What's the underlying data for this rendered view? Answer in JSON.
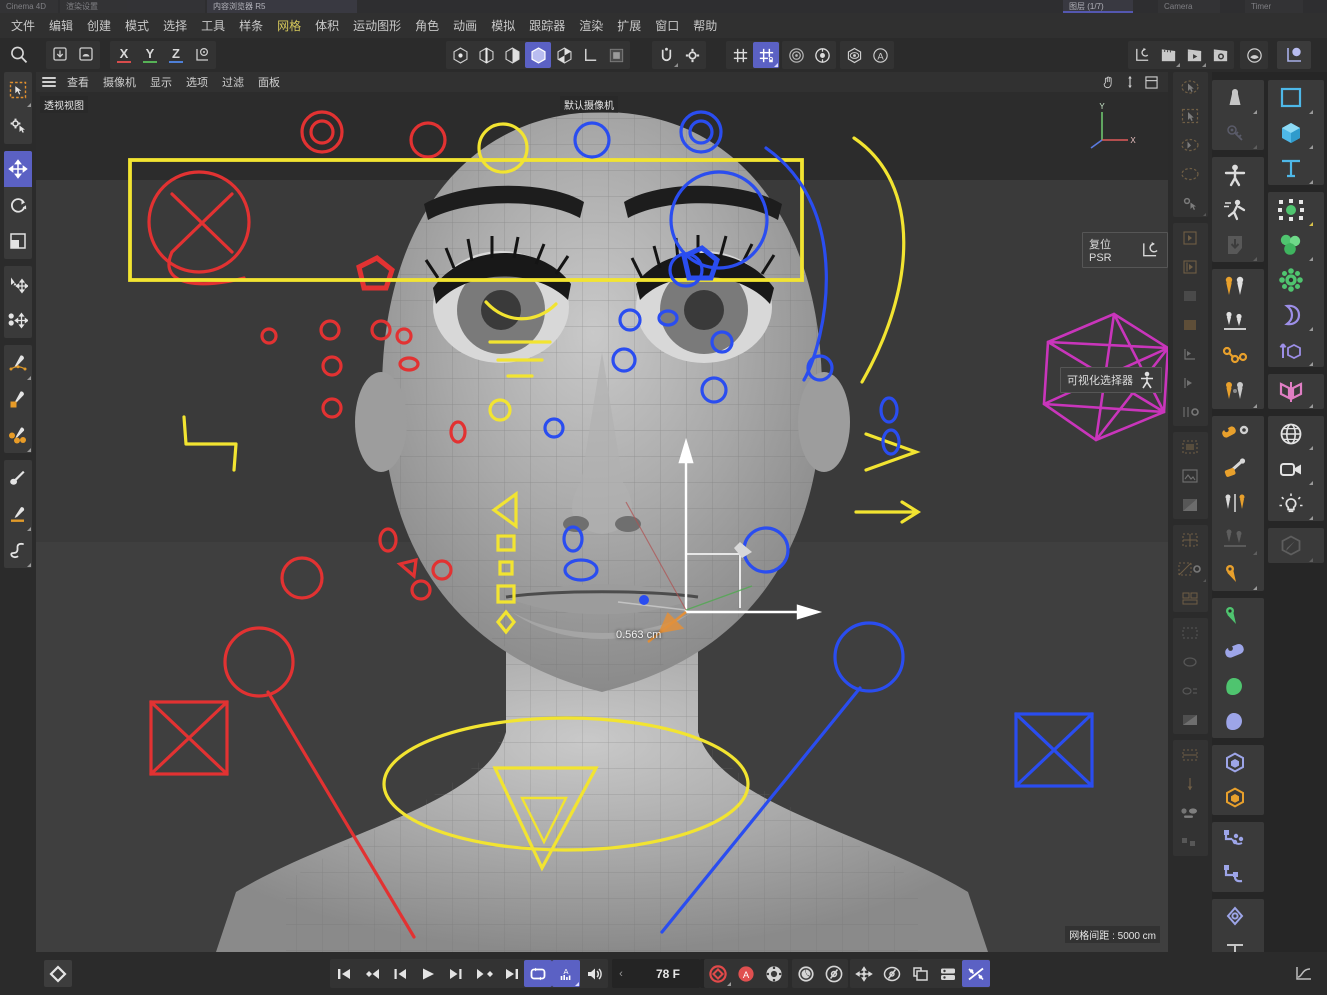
{
  "app": {
    "title_tabs": [
      {
        "label": "Cinema 4D",
        "active": false
      },
      {
        "label": "渲染设置",
        "active": false
      },
      {
        "label": "内容浏览器 R5",
        "active": false
      },
      {
        "label": "图层 (1/7)",
        "active": true,
        "accent": "#5b5fc7"
      },
      {
        "label": "Camera",
        "active": false
      },
      {
        "label": "Timer",
        "active": false
      }
    ],
    "accent_color": "#5b61c4",
    "highlight_color": "#d4c75a"
  },
  "menubar": {
    "items": [
      {
        "label": "文件",
        "highlight": false
      },
      {
        "label": "编辑",
        "highlight": false
      },
      {
        "label": "创建",
        "highlight": false
      },
      {
        "label": "模式",
        "highlight": false
      },
      {
        "label": "选择",
        "highlight": false
      },
      {
        "label": "工具",
        "highlight": false
      },
      {
        "label": "样条",
        "highlight": false
      },
      {
        "label": "网格",
        "highlight": true
      },
      {
        "label": "体积",
        "highlight": false
      },
      {
        "label": "运动图形",
        "highlight": false
      },
      {
        "label": "角色",
        "highlight": false
      },
      {
        "label": "动画",
        "highlight": false
      },
      {
        "label": "模拟",
        "highlight": false
      },
      {
        "label": "跟踪器",
        "highlight": false
      },
      {
        "label": "渲染",
        "highlight": false
      },
      {
        "label": "扩展",
        "highlight": false
      },
      {
        "label": "窗口",
        "highlight": false
      },
      {
        "label": "帮助",
        "highlight": false
      }
    ]
  },
  "toolbar": {
    "axis_labels": [
      "X",
      "Y",
      "Z"
    ],
    "axis_colors": [
      "#d84c4c",
      "#56b256",
      "#4e7fd6"
    ],
    "icons": [
      {
        "name": "undo-icon"
      },
      {
        "name": "redo-icon"
      },
      {
        "name": "point-mode-icon"
      },
      {
        "name": "edge-mode-icon"
      },
      {
        "name": "polygon-mode-icon"
      },
      {
        "name": "model-mode-icon",
        "selected": true
      },
      {
        "name": "object-axis-icon"
      },
      {
        "name": "world-axis-icon"
      },
      {
        "name": "texture-mode-icon"
      },
      {
        "name": "snap-icon"
      },
      {
        "name": "snap-settings-icon"
      },
      {
        "name": "grid-snap-icon"
      },
      {
        "name": "workplane-snap-icon",
        "selected": true
      },
      {
        "name": "render-view-icon"
      },
      {
        "name": "render-region-icon"
      },
      {
        "name": "render-settings-icon"
      },
      {
        "name": "content-browser-icon"
      },
      {
        "name": "reset-psr-icon"
      },
      {
        "name": "keyframe-recorder-icon"
      },
      {
        "name": "timeline-icon"
      },
      {
        "name": "animation-settings-icon"
      },
      {
        "name": "material-preview-icon"
      },
      {
        "name": "coord-widget-icon"
      }
    ]
  },
  "left_toolbar": {
    "groups": [
      {
        "items": [
          {
            "name": "live-selection-icon",
            "selected": false,
            "corner": true
          },
          {
            "name": "selection-settings-icon",
            "selected": false,
            "corner": false
          }
        ]
      },
      {
        "items": [
          {
            "name": "move-tool-icon",
            "selected": true,
            "corner": false
          },
          {
            "name": "rotate-tool-icon",
            "selected": false,
            "corner": false
          },
          {
            "name": "scale-tool-icon",
            "selected": false,
            "corner": false
          }
        ]
      },
      {
        "items": [
          {
            "name": "magnet-move-icon",
            "selected": false,
            "corner": false
          },
          {
            "name": "soft-selection-icon",
            "selected": false,
            "corner": false
          }
        ]
      },
      {
        "items": [
          {
            "name": "spline-pen-icon",
            "selected": false,
            "corner": true
          },
          {
            "name": "spline-draw-icon",
            "selected": false,
            "corner": false
          },
          {
            "name": "polygon-pen-icon",
            "selected": false,
            "corner": true
          }
        ]
      },
      {
        "items": [
          {
            "name": "brush-tool-icon",
            "selected": false,
            "corner": false
          },
          {
            "name": "sculpt-tool-icon",
            "selected": false,
            "corner": true
          },
          {
            "name": "spline-smooth-icon",
            "selected": false,
            "corner": true
          }
        ]
      }
    ]
  },
  "viewport": {
    "menu": [
      "查看",
      "摄像机",
      "显示",
      "选项",
      "过滤",
      "面板"
    ],
    "menu_icon": "hamburger-icon",
    "right_icons": [
      "hand-pan-icon",
      "zoom-axis-icon",
      "maximize-view-icon"
    ],
    "label_view": "透视视图",
    "label_camera": "默认摄像机",
    "label_grid": "网格间距 : 5000 cm",
    "measurement": "0.563 cm",
    "axis_gizmo_labels": [
      "Y",
      "X"
    ],
    "hud_reset_psr": "复位 PSR",
    "hud_visual_selector": "可视化选择器",
    "annotation_colors": {
      "red": "#e23232",
      "yellow": "#f2e431",
      "blue": "#2a4df0",
      "magenta": "#c935bb",
      "crimson": "#e02050",
      "azure": "#2a8ed9"
    }
  },
  "right_panel_a": {
    "groups": [
      {
        "items": [
          {
            "name": "weight-tool-icon",
            "corner": true
          },
          {
            "name": "pin-constraint-icon",
            "corner": true,
            "dim": true
          }
        ]
      },
      {
        "items": [
          {
            "name": "character-object-icon"
          },
          {
            "name": "walk-cycle-icon"
          },
          {
            "name": "bind-icon",
            "corner": true,
            "dim": true
          }
        ]
      },
      {
        "items": [
          {
            "name": "joint-tool-icon"
          },
          {
            "name": "joint-align-icon"
          },
          {
            "name": "ik-chain-icon"
          },
          {
            "name": "joint-mirror-icon",
            "corner": true
          }
        ]
      },
      {
        "items": [
          {
            "name": "joint-settings-icon",
            "corner": false
          },
          {
            "name": "skin-brush-icon"
          },
          {
            "name": "weight-mirror-icon"
          },
          {
            "name": "weight-tool-dim-icon",
            "dim": true,
            "corner": true
          },
          {
            "name": "joint-create-icon",
            "corner": true
          }
        ]
      },
      {
        "items": [
          {
            "name": "cloth-joint-icon"
          },
          {
            "name": "constraint-tag-icon"
          },
          {
            "name": "muscle-icon"
          },
          {
            "name": "muscle-deformer-icon"
          }
        ]
      },
      {
        "items": [
          {
            "name": "metaball-icon"
          },
          {
            "name": "hexagon-object-icon"
          }
        ]
      },
      {
        "items": [
          {
            "name": "xpresso-node-icon"
          },
          {
            "name": "hierarchy-node-icon"
          }
        ]
      },
      {
        "items": [
          {
            "name": "morph-icon"
          },
          {
            "name": "text-object-icon"
          }
        ]
      }
    ]
  },
  "right_panel_b": {
    "groups": [
      {
        "items": [
          {
            "name": "rectangle-spline-icon",
            "corner": true
          },
          {
            "name": "cube-primitive-icon",
            "corner": true
          },
          {
            "name": "text-spline-icon",
            "corner": true
          }
        ]
      },
      {
        "items": [
          {
            "name": "array-object-icon",
            "corner": true,
            "corner_yellow": true
          },
          {
            "name": "cloner-object-icon",
            "corner": true
          },
          {
            "name": "effector-icon"
          },
          {
            "name": "deformer-icon",
            "corner": true
          },
          {
            "name": "extrude-icon",
            "corner": true
          }
        ]
      },
      {
        "items": [
          {
            "name": "symmetry-icon",
            "corner": true
          }
        ]
      },
      {
        "items": [
          {
            "name": "environment-sky-icon",
            "corner": true
          },
          {
            "name": "camera-object-icon",
            "corner": true
          },
          {
            "name": "light-object-icon",
            "corner": true
          }
        ]
      },
      {
        "items": [
          {
            "name": "paint-tool-icon",
            "corner": true,
            "dim": true
          }
        ]
      }
    ]
  },
  "narrow_column": {
    "groups": [
      {
        "items": [
          [
            "live-selection-dim-icon"
          ],
          [
            "rect-selection-dim-icon"
          ],
          [
            "lasso-selection-dim-icon"
          ],
          [
            "poly-selection-dim-icon"
          ],
          [
            "selection-settings-dim-icon"
          ]
        ]
      },
      {
        "items": [
          [
            "uv-point-dim-icon"
          ],
          [
            "uv-edge-dim-icon"
          ],
          [
            "uv-fill-dim-icon"
          ],
          [
            "uv-orange-dim-icon"
          ],
          [
            "uv-frame-dim-icon"
          ],
          [
            "uv-play-dim-icon"
          ],
          [
            "uv-gear-dim-icon"
          ]
        ]
      },
      {
        "items": [
          [
            "bake-dim-icon"
          ],
          [
            "image-dim-icon"
          ],
          [
            "texture-dim-icon"
          ]
        ]
      },
      {
        "items": [
          [
            "uv-grid-dim-icon"
          ],
          [
            "uv-relax-gear-dim-icon"
          ],
          [
            "uv-pack-dim-icon"
          ]
        ]
      },
      {
        "items": [
          [
            "uv-a-dim-icon"
          ],
          [
            "uv-b-dim-icon"
          ],
          [
            "uv-c-dim-icon"
          ],
          [
            "gradient-dim-icon"
          ]
        ]
      },
      {
        "items": [
          [
            "align-dim-icon"
          ],
          [
            "distribute-dim-icon"
          ],
          [
            "dots-dim-icon"
          ],
          [
            "scatter-dim-icon"
          ]
        ]
      }
    ]
  },
  "bottom_bar": {
    "keyframe_marker_icon": "keyframe-diamond-icon",
    "transport": [
      {
        "name": "go-to-start-icon"
      },
      {
        "name": "prev-keyframe-icon"
      },
      {
        "name": "step-back-icon"
      },
      {
        "name": "play-icon"
      },
      {
        "name": "step-forward-icon"
      },
      {
        "name": "next-keyframe-icon"
      },
      {
        "name": "go-to-end-icon"
      }
    ],
    "mode_buttons": [
      {
        "name": "loop-playback-icon",
        "selected": true
      },
      {
        "name": "autokey-sound-icon",
        "selected": true
      },
      {
        "name": "sound-icon",
        "selected": false
      }
    ],
    "frame_value": "78 F",
    "frame_prev_arrow": "‹",
    "frame_next_arrow": "›",
    "record_buttons": [
      {
        "name": "record-keyframe-icon",
        "color": "#e24a4a"
      },
      {
        "name": "autokeying-icon",
        "color": "#e24a4a",
        "label": "A"
      },
      {
        "name": "keyframe-settings-icon",
        "color": "#d8d8d8"
      }
    ],
    "key_mode_buttons": [
      {
        "name": "key-position-icon"
      },
      {
        "name": "key-rotation-icon"
      }
    ],
    "param_buttons": [
      {
        "name": "param-position-icon",
        "selected": false
      },
      {
        "name": "param-rotation-icon",
        "selected": false
      },
      {
        "name": "param-scale-icon",
        "selected": false
      },
      {
        "name": "param-parameter-icon",
        "selected": false
      },
      {
        "name": "param-pla-icon",
        "selected": true
      }
    ],
    "right_icon": "timeline-curve-icon"
  }
}
